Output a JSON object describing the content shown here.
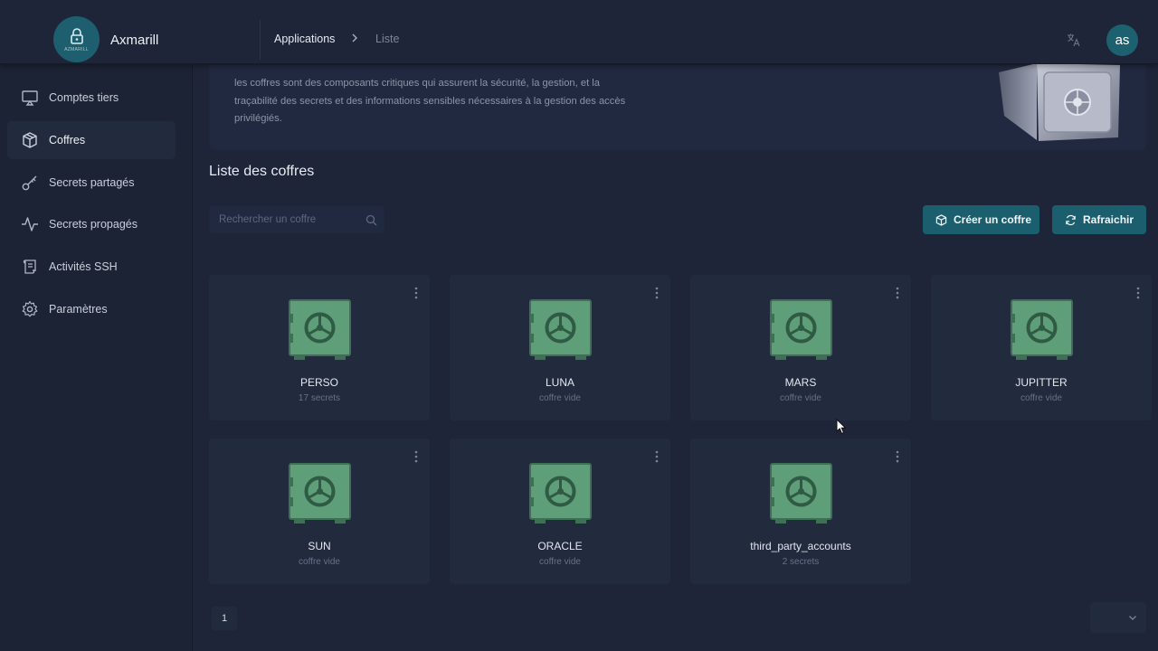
{
  "app": {
    "name": "Axmarill",
    "logo_text": "AZMARILL"
  },
  "breadcrumb": {
    "items": [
      "Applications",
      "Liste"
    ]
  },
  "user": {
    "initials": "as"
  },
  "sidebar": {
    "items": [
      {
        "label": "Comptes tiers",
        "icon": "monitor-icon"
      },
      {
        "label": "Coffres",
        "icon": "cube-icon",
        "active": true
      },
      {
        "label": "Secrets partagés",
        "icon": "key-icon"
      },
      {
        "label": "Secrets propagés",
        "icon": "activity-icon"
      },
      {
        "label": "Activités SSH",
        "icon": "scroll-icon"
      },
      {
        "label": "Paramètres",
        "icon": "gear-icon"
      }
    ]
  },
  "banner": {
    "lines": [
      "les coffres sont des composants critiques qui assurent la sécurité, la gestion, et la",
      "traçabilité des secrets et des informations sensibles nécessaires à la gestion des accès",
      "privilégiés."
    ]
  },
  "main": {
    "title": "Liste des coffres",
    "search_placeholder": "Rechercher un coffre",
    "create_label": "Créer un coffre",
    "refresh_label": "Rafraichir"
  },
  "vaults": [
    {
      "name": "PERSO",
      "sub": "17 secrets"
    },
    {
      "name": "LUNA",
      "sub": "coffre vide"
    },
    {
      "name": "MARS",
      "sub": "coffre vide"
    },
    {
      "name": "JUPITTER",
      "sub": "coffre vide"
    },
    {
      "name": "SUN",
      "sub": "coffre vide"
    },
    {
      "name": "ORACLE",
      "sub": "coffre vide"
    },
    {
      "name": "third_party_accounts",
      "sub": "2 secrets"
    }
  ],
  "pagination": {
    "current_page": "1"
  },
  "colors": {
    "accent": "#1b5f6f",
    "safe_green": "#5e9e78",
    "background": "#1e2538"
  }
}
